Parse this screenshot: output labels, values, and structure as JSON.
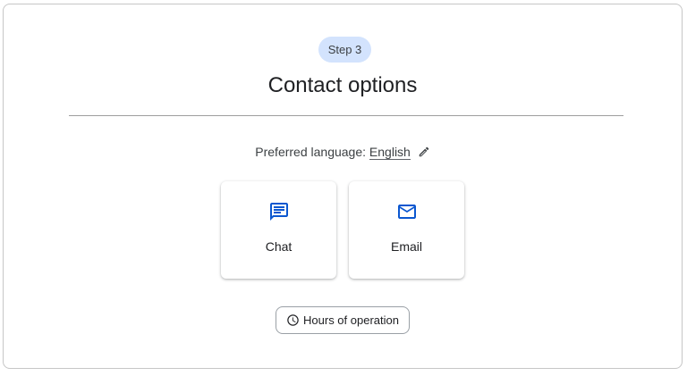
{
  "step": {
    "label": "Step 3"
  },
  "page": {
    "title": "Contact options"
  },
  "language": {
    "prefix": "Preferred language:",
    "value": "English",
    "edit_icon": "pencil-icon"
  },
  "options": [
    {
      "label": "Chat",
      "icon": "chat-icon"
    },
    {
      "label": "Email",
      "icon": "mail-icon"
    }
  ],
  "hours_button": {
    "label": "Hours of operation",
    "icon": "clock-icon"
  },
  "colors": {
    "accent": "#0b57d0",
    "chip_bg": "#d3e3fd",
    "text": "#202124",
    "border": "#c6c6c6"
  }
}
